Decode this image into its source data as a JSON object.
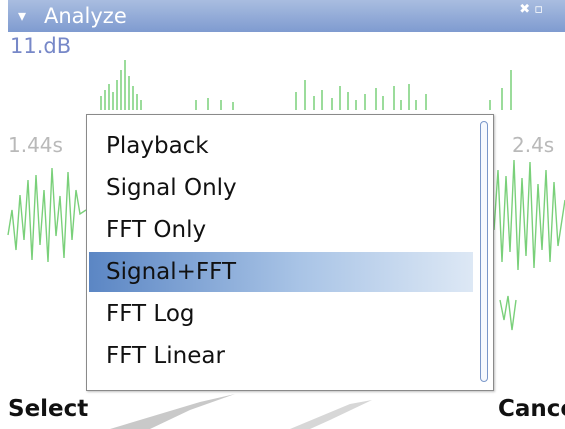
{
  "title_bar": {
    "title": "Analyze",
    "menu_icon": "triangle-down-icon",
    "status_icons": "signal-and-battery-icons"
  },
  "waveform": {
    "level_label": "11.dB",
    "time_start": "1.44s",
    "time_end": "2.4s",
    "color": "#7ad07a"
  },
  "popup_menu": {
    "items": [
      {
        "label": "Playback"
      },
      {
        "label": "Signal Only"
      },
      {
        "label": "FFT Only"
      },
      {
        "label": "Signal+FFT",
        "selected": true
      },
      {
        "label": "FFT Log"
      },
      {
        "label": "FFT Linear"
      }
    ],
    "highlight_color": "#5b86c4"
  },
  "softkeys": {
    "left": "Select",
    "right": "Cancel"
  },
  "colors": {
    "title_bar": "#7f9bd0",
    "level_label": "#7788c8",
    "time_label": "#b9b9b9"
  }
}
